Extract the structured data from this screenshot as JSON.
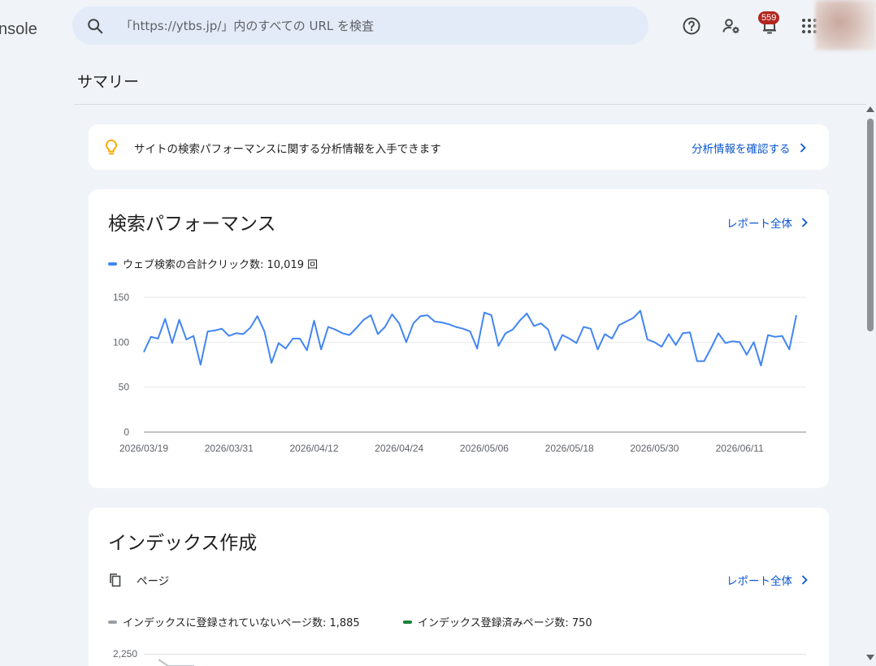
{
  "header": {
    "app_name_fragment": "nsole",
    "search_placeholder": "「https://ytbs.jp/」内のすべての URL を検査",
    "notification_count": "559",
    "icons": [
      "search-icon",
      "help-icon",
      "manage-users-icon",
      "notifications-icon",
      "apps-grid-icon",
      "account-avatar"
    ]
  },
  "page": {
    "title": "サマリー"
  },
  "insight": {
    "text": "サイトの検索パフォーマンスに関する分析情報を入手できます",
    "link": "分析情報を確認する",
    "icon": "lightbulb-icon",
    "icon_color": "#f9ab00"
  },
  "performance": {
    "title": "検索パフォーマンス",
    "link": "レポート全体",
    "legend": "ウェブ検索の合計クリック数: 10,019 回",
    "line_color": "#4285f4"
  },
  "chart_data": [
    {
      "type": "line",
      "title": "",
      "xlabel": "",
      "ylabel": "",
      "ylim": [
        0,
        150
      ],
      "yticks": [
        0,
        50,
        100,
        150
      ],
      "xtick_labels": [
        "2026/03/19",
        "2026/03/31",
        "2026/04/12",
        "2026/04/24",
        "2026/05/06",
        "2026/05/18",
        "2026/05/30",
        "2026/06/11"
      ],
      "grid": true,
      "series": [
        {
          "name": "ウェブ検索の合計クリック数",
          "color": "#4285f4",
          "values": [
            89,
            106,
            104,
            126,
            99,
            125,
            103,
            107,
            75,
            112,
            113,
            115,
            107,
            110,
            109,
            116,
            129,
            112,
            77,
            99,
            93,
            104,
            104,
            91,
            124,
            92,
            117,
            114,
            110,
            108,
            116,
            125,
            130,
            109,
            117,
            131,
            121,
            100,
            121,
            129,
            130,
            123,
            122,
            120,
            117,
            115,
            112,
            93,
            133,
            130,
            96,
            110,
            114,
            124,
            132,
            118,
            121,
            114,
            91,
            108,
            104,
            99,
            117,
            115,
            92,
            109,
            104,
            119,
            123,
            127,
            135,
            103,
            100,
            95,
            109,
            97,
            110,
            111,
            79,
            79,
            94,
            110,
            99,
            101,
            100,
            86,
            100,
            74,
            108,
            106,
            107,
            92,
            130
          ]
        }
      ]
    },
    {
      "type": "line",
      "title": "",
      "yticks_visible": [
        "2,250"
      ],
      "series": [
        {
          "name": "インデックスに登録されていないページ数",
          "color": "#9aa0a6"
        },
        {
          "name": "インデックス登録済みページ数",
          "color": "#188038"
        }
      ]
    }
  ],
  "indexing": {
    "title": "インデックス作成",
    "subheading": "ページ",
    "link": "レポート全体",
    "legend_not_indexed": "インデックスに登録されていないページ数: 1,885",
    "legend_indexed": "インデックス登録済みページ数: 750",
    "tick_2250": "2,250",
    "not_indexed_color": "#9aa0a6",
    "indexed_color": "#188038"
  }
}
